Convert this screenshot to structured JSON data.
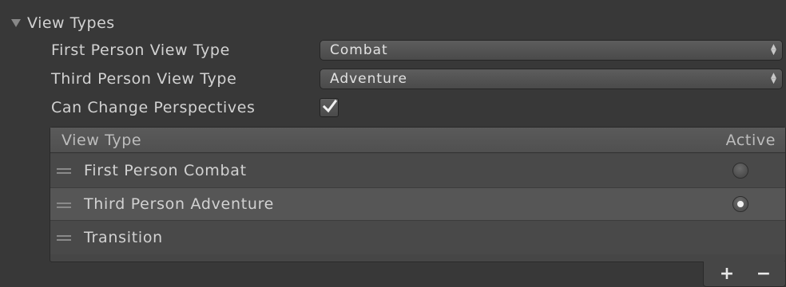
{
  "foldout": {
    "label": "View Types"
  },
  "properties": {
    "first_person": {
      "label": "First Person View Type",
      "value": "Combat"
    },
    "third_person": {
      "label": "Third Person View Type",
      "value": "Adventure"
    },
    "can_change": {
      "label": "Can Change Perspectives",
      "checked": true
    }
  },
  "list": {
    "header": {
      "col_name": "View Type",
      "col_active": "Active"
    },
    "rows": [
      {
        "name": "First Person Combat",
        "active": false
      },
      {
        "name": "Third Person Adventure",
        "active": true
      },
      {
        "name": "Transition",
        "active": false
      }
    ]
  },
  "footer": {
    "add_label": "+",
    "remove_label": "−"
  },
  "icons": {
    "foldout": "triangle-down-icon",
    "popup": "up-down-arrows-icon",
    "checkbox": "checkmark-icon",
    "drag": "drag-handle-icon"
  }
}
